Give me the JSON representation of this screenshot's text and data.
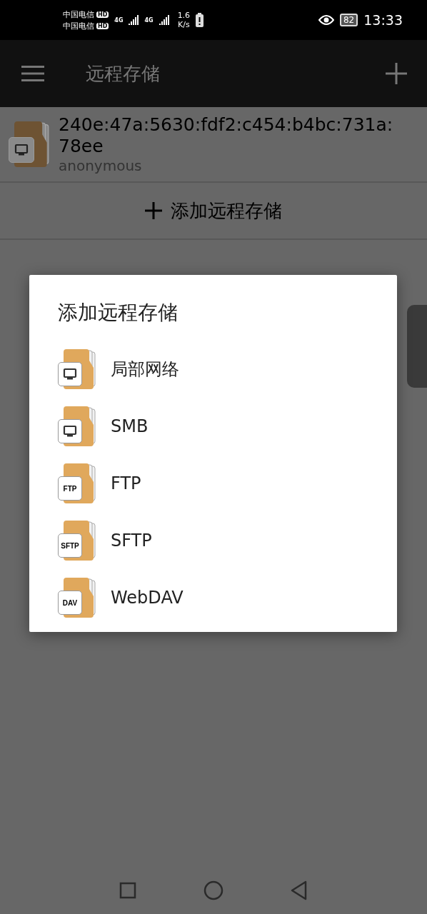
{
  "status_bar": {
    "carriers": [
      {
        "name": "中国电信",
        "badge": "HD"
      },
      {
        "name": "中国电信",
        "badge": "HD"
      }
    ],
    "network_types": [
      "4G",
      "4G"
    ],
    "speed_value": "1.6",
    "speed_unit": "K/s",
    "battery": "82",
    "time": "13:33"
  },
  "app_bar": {
    "title": "远程存储"
  },
  "storages": [
    {
      "kind": "monitor",
      "title": "240e:47a:5630:fdf2:c454:b4bc:731a:78ee",
      "subtitle": "anonymous"
    }
  ],
  "add_button": {
    "label": "添加远程存储"
  },
  "dialog": {
    "title": "添加远程存储",
    "options": [
      {
        "kind": "monitor",
        "label": "局部网络"
      },
      {
        "kind": "monitor",
        "label": "SMB"
      },
      {
        "kind": "tag",
        "tag": "FTP",
        "label": "FTP"
      },
      {
        "kind": "tag",
        "tag": "SFTP",
        "label": "SFTP"
      },
      {
        "kind": "tag",
        "tag": "DAV",
        "label": "WebDAV"
      }
    ]
  }
}
